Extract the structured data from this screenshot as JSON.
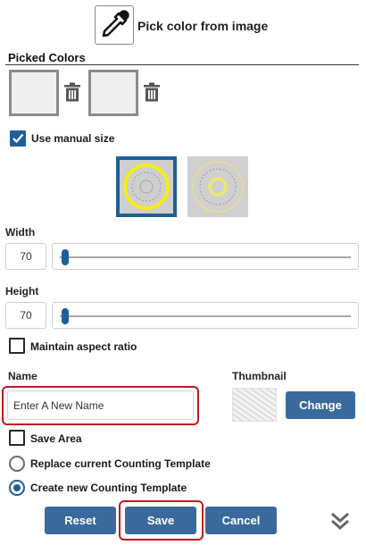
{
  "pick_color": {
    "label": "Pick color from image",
    "icon": "eyedropper-icon"
  },
  "picked_colors": {
    "title": "Picked Colors",
    "swatches": [
      {
        "color": "#efefef",
        "delete_icon": "trash-icon"
      },
      {
        "color": "#efefef",
        "delete_icon": "trash-icon"
      }
    ]
  },
  "manual_size": {
    "label": "Use manual size",
    "checked": true
  },
  "shapes": [
    {
      "name": "large-ring",
      "selected": true,
      "ring_color": "#f5ec1a"
    },
    {
      "name": "small-ring",
      "selected": false,
      "ring_color": "#efe86a"
    }
  ],
  "width": {
    "label": "Width",
    "value": "70",
    "slider_fraction": 0.03
  },
  "height": {
    "label": "Height",
    "value": "70",
    "slider_fraction": 0.03
  },
  "aspect": {
    "label": "Maintain aspect ratio",
    "checked": false
  },
  "name": {
    "label": "Name",
    "placeholder": "Enter A New Name",
    "value": ""
  },
  "thumbnail": {
    "label": "Thumbnail",
    "change_label": "Change"
  },
  "save_area": {
    "label": "Save Area",
    "checked": false
  },
  "template_options": [
    {
      "label": "Replace current Counting Template",
      "selected": false
    },
    {
      "label": "Create new Counting Template",
      "selected": true
    }
  ],
  "actions": {
    "reset": "Reset",
    "save": "Save",
    "cancel": "Cancel",
    "more_icon": "double-chevron-down-icon"
  },
  "colors": {
    "accent": "#1f5f96",
    "button": "#3a6a9b",
    "highlight": "#c41a1a"
  }
}
